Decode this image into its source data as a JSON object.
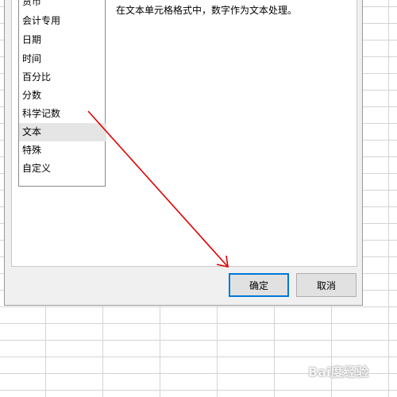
{
  "format_dialog": {
    "categories": [
      {
        "label": "货币",
        "selected": false
      },
      {
        "label": "会计专用",
        "selected": false
      },
      {
        "label": "日期",
        "selected": false
      },
      {
        "label": "时间",
        "selected": false
      },
      {
        "label": "百分比",
        "selected": false
      },
      {
        "label": "分数",
        "selected": false
      },
      {
        "label": "科学记数",
        "selected": false
      },
      {
        "label": "文本",
        "selected": true
      },
      {
        "label": "特殊",
        "selected": false
      },
      {
        "label": "自定义",
        "selected": false
      }
    ],
    "description": "在文本单元格格式中，数字作为文本处理。",
    "ok_label": "确定",
    "cancel_label": "取消"
  },
  "annotation": {
    "arrow_color": "#e00000"
  },
  "watermark": {
    "text": "Bai度经验"
  },
  "colors": {
    "selection": "#e5e5e5",
    "focus_border": "#0078d7"
  }
}
